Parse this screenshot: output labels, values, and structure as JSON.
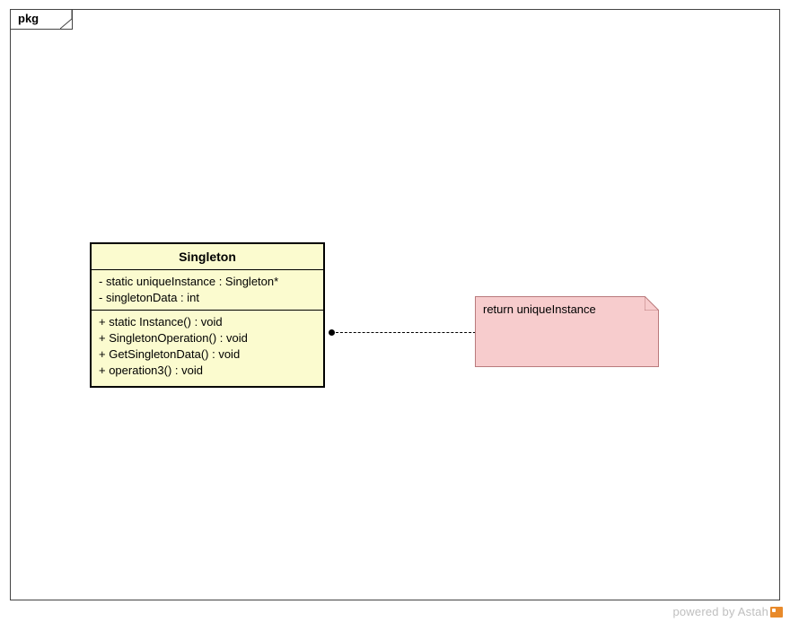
{
  "package": {
    "label": "pkg"
  },
  "class": {
    "name": "Singleton",
    "attributes": [
      "- static uniqueInstance : Singleton*",
      "- singletonData : int"
    ],
    "operations": [
      "+ static Instance() : void",
      "+ SingletonOperation() : void",
      "+ GetSingletonData() : void",
      "+ operation3() : void"
    ]
  },
  "note": {
    "text": "return uniqueInstance"
  },
  "footer": {
    "credit_prefix": "powered by ",
    "brand": "Astah"
  }
}
